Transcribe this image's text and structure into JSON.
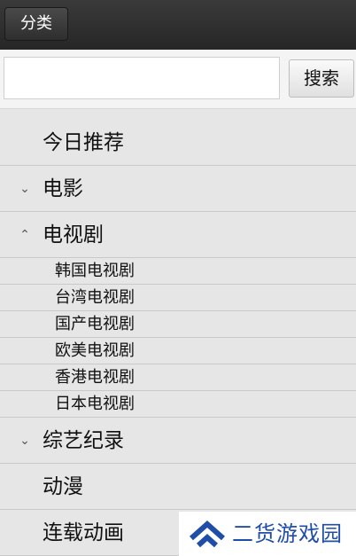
{
  "header": {
    "category_button": "分类"
  },
  "search": {
    "value": "",
    "placeholder": "",
    "button_label": "搜索"
  },
  "menu": {
    "today": "今日推荐",
    "movies": {
      "label": "电影",
      "expanded": false
    },
    "tv": {
      "label": "电视剧",
      "expanded": true,
      "children": [
        "韩国电视剧",
        "台湾电视剧",
        "国产电视剧",
        "欧美电视剧",
        "香港电视剧",
        "日本电视剧"
      ]
    },
    "variety": {
      "label": "综艺纪录",
      "expanded": false
    },
    "anime": "动漫",
    "serial_anime": "连载动画"
  },
  "icons": {
    "collapsed": "chevron-down-icon",
    "expanded": "chevron-up-icon"
  },
  "watermark": {
    "text": "二货游戏园",
    "color": "#1f4ea8"
  }
}
